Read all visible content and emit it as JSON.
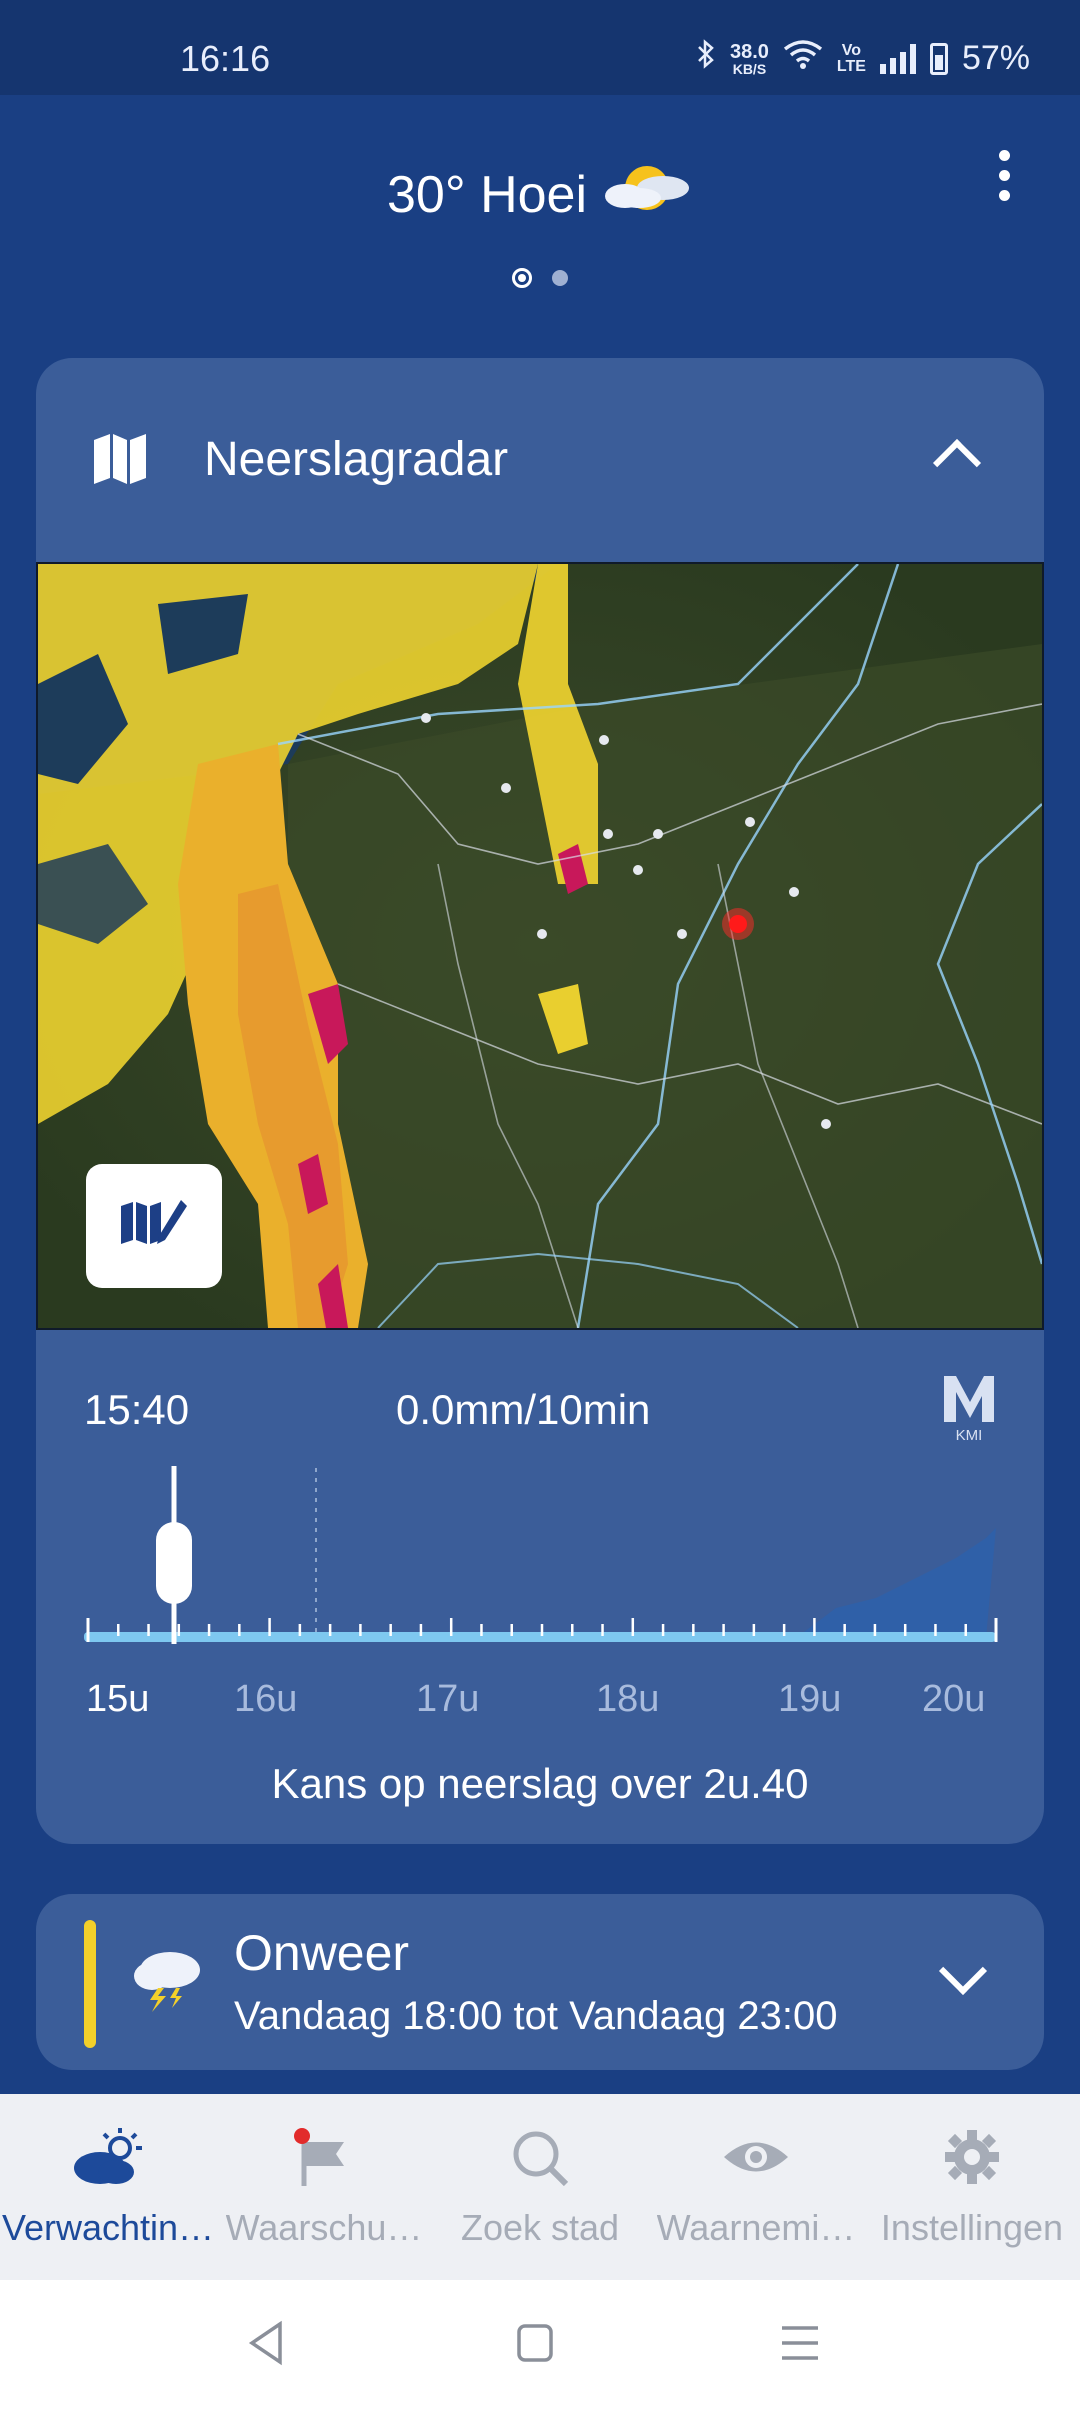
{
  "status_bar": {
    "time": "16:16",
    "speed_value": "38.0",
    "speed_unit": "KB/S",
    "volte": "Vo\nLTE",
    "battery": "57%"
  },
  "header": {
    "location_title": "30° Hoei",
    "weather_icon": "sun-cloud-icon",
    "menu_icon": "more-vert-icon"
  },
  "radar": {
    "title": "Neerslagradar",
    "time": "15:40",
    "amount": "0.0mm/10min",
    "logo_text": "KMI",
    "ticks": [
      "15u",
      "16u",
      "17u",
      "18u",
      "19u",
      "20u"
    ],
    "active_tick": "15u",
    "chance_text": "Kans op neerslag over 2u.40"
  },
  "warning": {
    "title": "Onweer",
    "subtitle": "Vandaag 18:00 tot Vandaag 23:00",
    "color": "#f3d02a"
  },
  "bottom_nav": {
    "items": [
      {
        "label": "Verwachtin…",
        "icon": "weather-icon",
        "active": true
      },
      {
        "label": "Waarschu…",
        "icon": "flag-icon",
        "active": false
      },
      {
        "label": "Zoek stad",
        "icon": "search-icon",
        "active": false
      },
      {
        "label": "Waarnemi…",
        "icon": "eye-icon",
        "active": false
      },
      {
        "label": "Instellingen",
        "icon": "gear-icon",
        "active": false
      }
    ]
  },
  "colors": {
    "background": "#1a3f83",
    "card": "#3b5d99",
    "accent": "#1d4a9a",
    "warning": "#f3d02a"
  }
}
